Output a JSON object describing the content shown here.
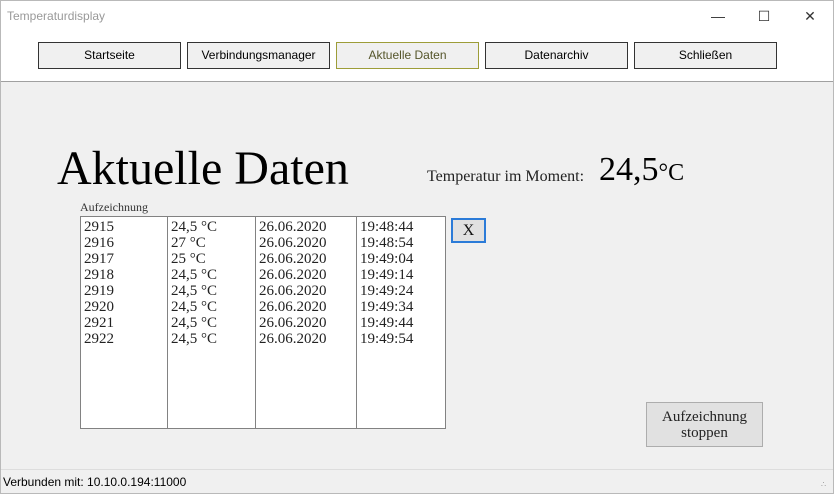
{
  "window": {
    "title": "Temperaturdisplay"
  },
  "window_controls": {
    "minimize": "—",
    "maximize": "☐",
    "close": "✕"
  },
  "nav": {
    "items": [
      {
        "label": "Startseite"
      },
      {
        "label": "Verbindungsmanager"
      },
      {
        "label": "Aktuelle Daten",
        "active": true
      },
      {
        "label": "Datenarchiv"
      },
      {
        "label": "Schließen"
      }
    ],
    "active_color": "#9d9d38"
  },
  "main": {
    "heading": "Aktuelle Daten",
    "current_label": "Temperatur im Moment:",
    "current_value": "24,5",
    "current_unit": "°C"
  },
  "recording": {
    "label": "Aufzeichnung",
    "ids": [
      "2915",
      "2916",
      "2917",
      "2918",
      "2919",
      "2920",
      "2921",
      "2922"
    ],
    "temps": [
      "24,5 °C",
      "27 °C",
      "25 °C",
      "24,5 °C",
      "24,5 °C",
      "24,5 °C",
      "24,5 °C",
      "24,5 °C"
    ],
    "dates": [
      "26.06.2020",
      "26.06.2020",
      "26.06.2020",
      "26.06.2020",
      "26.06.2020",
      "26.06.2020",
      "26.06.2020",
      "26.06.2020"
    ],
    "times": [
      "19:48:44",
      "19:48:54",
      "19:49:04",
      "19:49:14",
      "19:49:24",
      "19:49:34",
      "19:49:44",
      "19:49:54"
    ],
    "clear_label": "X",
    "stop_label_line1": "Aufzeichnung",
    "stop_label_line2": "stoppen"
  },
  "status": {
    "text": "Verbunden mit: 10.10.0.194:11000"
  },
  "colors": {
    "focus_border": "#2b7bd8",
    "window_bg": "#f0f0f0"
  }
}
